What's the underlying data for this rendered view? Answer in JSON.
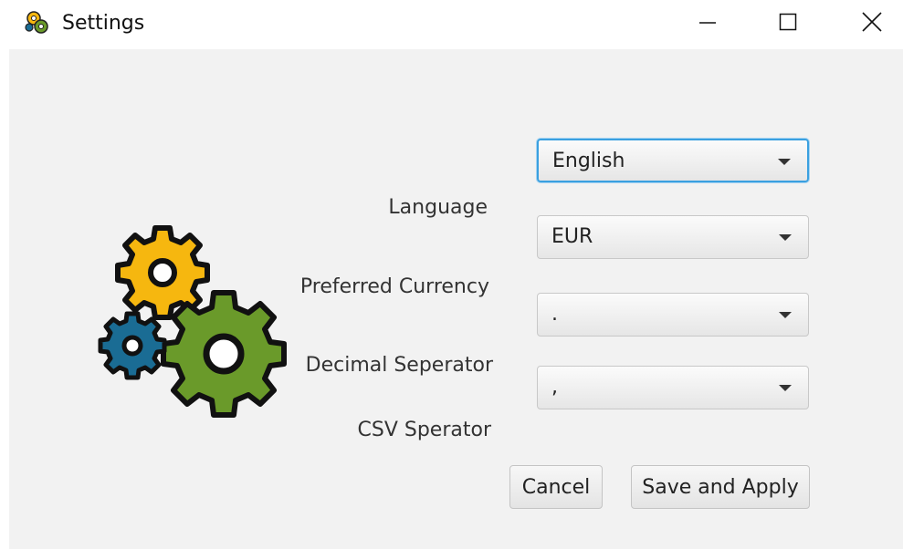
{
  "window": {
    "title": "Settings",
    "icon": "gears-icon",
    "controls": [
      "minimize-icon",
      "maximize-icon",
      "close-icon"
    ]
  },
  "form": {
    "language": {
      "label": "Language",
      "value": "English"
    },
    "currency": {
      "label": "Preferred Currency",
      "value": "EUR"
    },
    "decimal_separator": {
      "label": "Decimal Seperator",
      "value": "."
    },
    "csv_separator": {
      "label": "CSV Sperator",
      "value": ","
    }
  },
  "buttons": {
    "cancel": "Cancel",
    "save": "Save and Apply"
  },
  "colors": {
    "gear_yellow": "#f6b70f",
    "gear_green": "#6a9a2a",
    "gear_blue": "#1a6c94",
    "focus_border": "#3aa0e0",
    "panel_bg": "#f2f2f2"
  }
}
